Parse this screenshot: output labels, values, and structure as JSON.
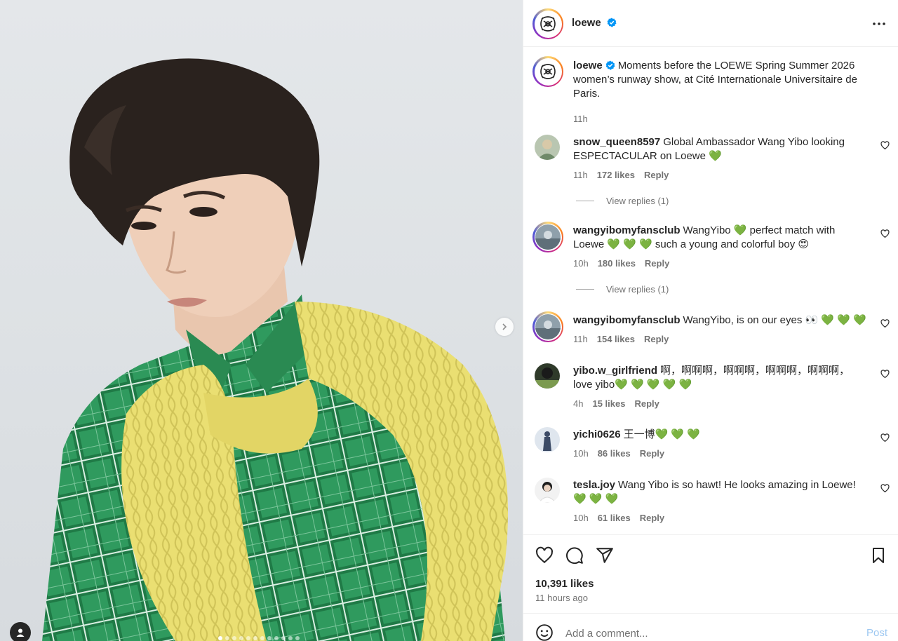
{
  "post": {
    "slide_count": 12,
    "active_slide": 1
  },
  "header": {
    "username": "loewe",
    "verified": true
  },
  "caption": {
    "username": "loewe",
    "text": "Moments before the LOEWE Spring Summer 2026 women’s runway show, at Cité Internationale Universitaire de Paris.",
    "time": "11h"
  },
  "comments": [
    {
      "username": "snow_queen8597",
      "text": "Global Ambassador Wang Yibo looking ESPECTACULAR on Loewe 💚",
      "time": "11h",
      "likes": "172 likes",
      "reply": "Reply",
      "view_replies": "View replies (1)"
    },
    {
      "username": "wangyibomyfansclub",
      "text": "WangYibo 💚 perfect match with Loewe 💚 💚 💚 such a young and colorful boy 😍",
      "time": "10h",
      "likes": "180 likes",
      "reply": "Reply",
      "view_replies": "View replies (1)"
    },
    {
      "username": "wangyibomyfansclub",
      "text": "WangYibo, is on our eyes 👀 💚 💚 💚",
      "time": "11h",
      "likes": "154 likes",
      "reply": "Reply"
    },
    {
      "username": "yibo.w_girlfriend",
      "text": "啊，啊啊啊，啊啊啊，啊啊啊，啊啊啊，love yibo💚 💚 💚 💚 💚",
      "time": "4h",
      "likes": "15 likes",
      "reply": "Reply"
    },
    {
      "username": "yichi0626",
      "text": "王一博💚 💚 💚",
      "time": "10h",
      "likes": "86 likes",
      "reply": "Reply"
    },
    {
      "username": "tesla.joy",
      "text": "Wang Yibo is so hawt! He looks amazing in Loewe! 💚 💚 💚",
      "time": "10h",
      "likes": "61 likes",
      "reply": "Reply"
    }
  ],
  "stats": {
    "likes": "10,391 likes",
    "posted": "11 hours ago"
  },
  "add_comment": {
    "placeholder": "Add a comment...",
    "post_label": "Post"
  },
  "colors": {
    "verified": "#0095f6",
    "post_disabled": "#9cc7f1",
    "muted_text": "#737373"
  },
  "icons": [
    "chevron-right-icon",
    "user-tag-icon",
    "more-icon",
    "heart-icon",
    "comment-icon",
    "share-icon",
    "bookmark-icon",
    "emoji-icon",
    "verified-badge-icon"
  ]
}
